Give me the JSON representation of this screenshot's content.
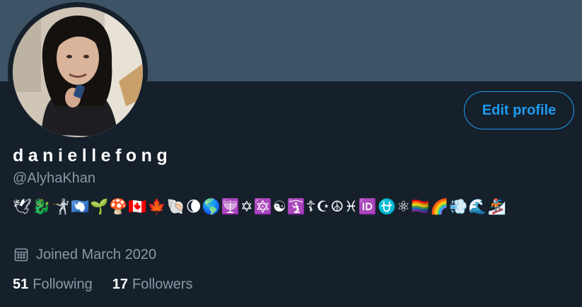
{
  "profile": {
    "display_name": "daniellefong",
    "handle": "@AlyhaKhan",
    "bio": "🕊🐉🤺🇦🇶🌱🍄🇨🇦🍁🐚🌘🌎🕎✡🔯☯🛐☦☪☮♓🆔⛎⚛🏳️‍🌈🌈💨🌊🏂",
    "joined": "Joined March 2020",
    "edit_label": "Edit profile",
    "following_count": "51",
    "following_label": "Following",
    "followers_count": "17",
    "followers_label": "Followers"
  },
  "icons": {
    "joined": "calendar-icon"
  },
  "colors": {
    "background": "#15202b",
    "banner": "#3d5366",
    "accent": "#1d9bf0",
    "secondary_text": "#8b98a5"
  }
}
